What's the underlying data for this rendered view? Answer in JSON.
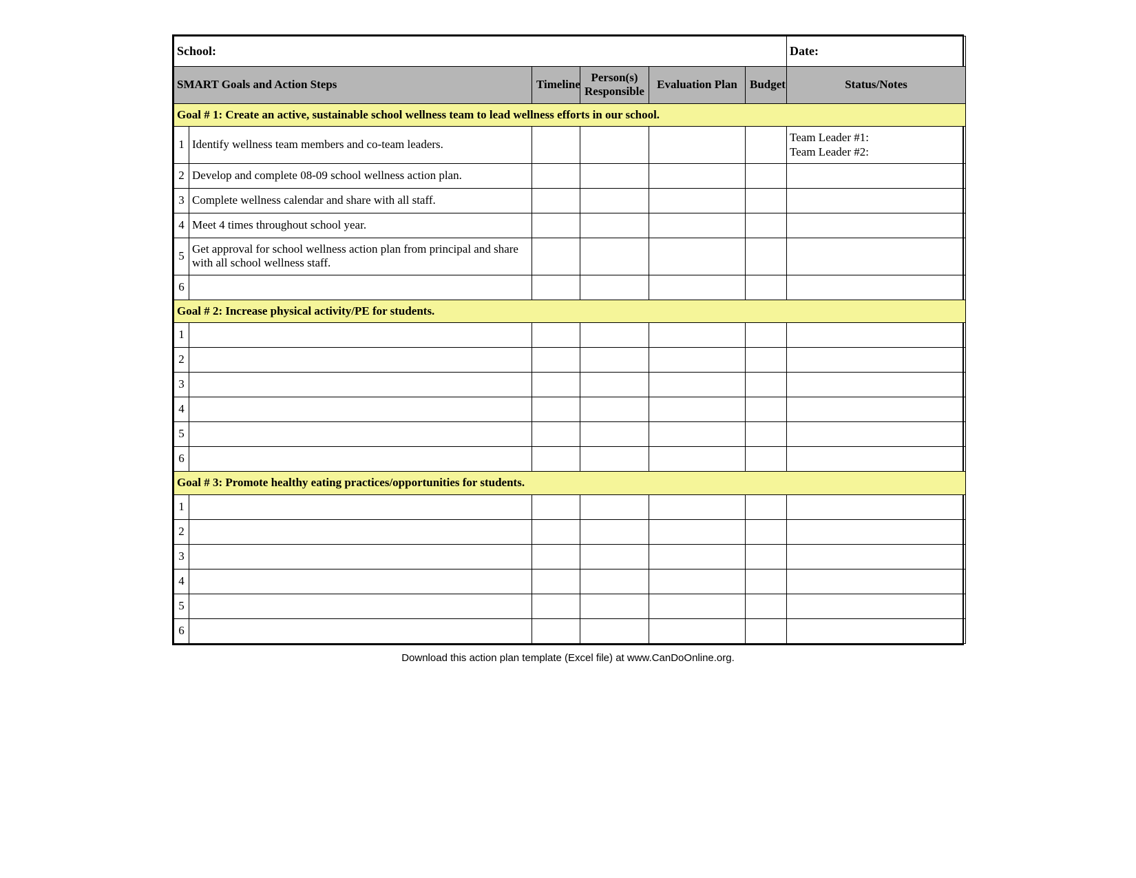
{
  "top": {
    "school_label": "School:",
    "date_label": "Date:"
  },
  "headers": {
    "goals": "SMART Goals and Action Steps",
    "timeline": "Timeline",
    "persons": "Person(s) Responsible",
    "evaluation": "Evaluation Plan",
    "budget": "Budget",
    "status": "Status/Notes"
  },
  "goals": [
    {
      "title": "Goal # 1: Create an active, sustainable school wellness team to lead wellness efforts in our school.",
      "steps": [
        {
          "n": "1",
          "desc": "Identify wellness team members and co-team leaders.",
          "timeline": "",
          "persons": "",
          "evaluation": "",
          "budget": "",
          "notes_lines": [
            "Team Leader #1:",
            "Team Leader #2:"
          ]
        },
        {
          "n": "2",
          "desc": "Develop and complete 08-09 school wellness action plan.",
          "timeline": "",
          "persons": "",
          "evaluation": "",
          "budget": "",
          "notes_lines": []
        },
        {
          "n": "3",
          "desc": "Complete wellness calendar and share with all staff.",
          "timeline": "",
          "persons": "",
          "evaluation": "",
          "budget": "",
          "notes_lines": []
        },
        {
          "n": "4",
          "desc": "Meet 4 times throughout school year.",
          "timeline": "",
          "persons": "",
          "evaluation": "",
          "budget": "",
          "notes_lines": []
        },
        {
          "n": "5",
          "desc": "Get approval for school wellness action plan from principal and share with all school wellness staff.",
          "timeline": "",
          "persons": "",
          "evaluation": "",
          "budget": "",
          "notes_lines": []
        },
        {
          "n": "6",
          "desc": "",
          "timeline": "",
          "persons": "",
          "evaluation": "",
          "budget": "",
          "notes_lines": []
        }
      ]
    },
    {
      "title": "Goal # 2: Increase physical activity/PE for students.",
      "steps": [
        {
          "n": "1",
          "desc": "",
          "timeline": "",
          "persons": "",
          "evaluation": "",
          "budget": "",
          "notes_lines": []
        },
        {
          "n": "2",
          "desc": "",
          "timeline": "",
          "persons": "",
          "evaluation": "",
          "budget": "",
          "notes_lines": []
        },
        {
          "n": "3",
          "desc": "",
          "timeline": "",
          "persons": "",
          "evaluation": "",
          "budget": "",
          "notes_lines": []
        },
        {
          "n": "4",
          "desc": "",
          "timeline": "",
          "persons": "",
          "evaluation": "",
          "budget": "",
          "notes_lines": []
        },
        {
          "n": "5",
          "desc": "",
          "timeline": "",
          "persons": "",
          "evaluation": "",
          "budget": "",
          "notes_lines": []
        },
        {
          "n": "6",
          "desc": "",
          "timeline": "",
          "persons": "",
          "evaluation": "",
          "budget": "",
          "notes_lines": []
        }
      ]
    },
    {
      "title": "Goal # 3: Promote healthy eating practices/opportunities for students.",
      "steps": [
        {
          "n": "1",
          "desc": "",
          "timeline": "",
          "persons": "",
          "evaluation": "",
          "budget": "",
          "notes_lines": []
        },
        {
          "n": "2",
          "desc": "",
          "timeline": "",
          "persons": "",
          "evaluation": "",
          "budget": "",
          "notes_lines": []
        },
        {
          "n": "3",
          "desc": "",
          "timeline": "",
          "persons": "",
          "evaluation": "",
          "budget": "",
          "notes_lines": []
        },
        {
          "n": "4",
          "desc": "",
          "timeline": "",
          "persons": "",
          "evaluation": "",
          "budget": "",
          "notes_lines": []
        },
        {
          "n": "5",
          "desc": "",
          "timeline": "",
          "persons": "",
          "evaluation": "",
          "budget": "",
          "notes_lines": []
        },
        {
          "n": "6",
          "desc": "",
          "timeline": "",
          "persons": "",
          "evaluation": "",
          "budget": "",
          "notes_lines": []
        }
      ]
    }
  ],
  "footer": "Download this action plan template (Excel file) at www.CanDoOnline.org."
}
